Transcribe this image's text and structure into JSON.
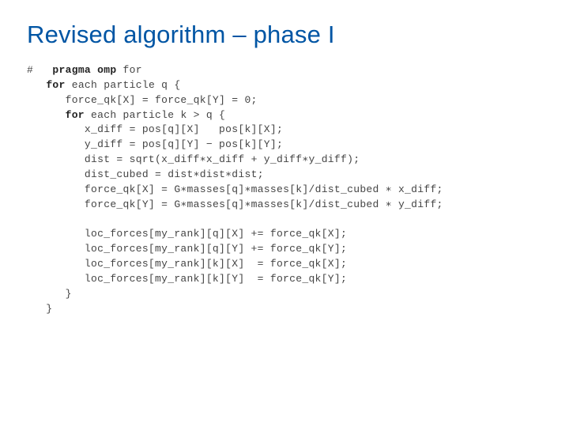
{
  "title": "Revised algorithm – phase I",
  "code": {
    "hash": "#",
    "kw_pragma": "pragma omp",
    "kw_for": "for",
    "pragma_rest": "for",
    "for1_rest": "each particle q {",
    "l1": "      force_qk[X] = force_qk[Y] = 0;",
    "for2_rest": "each particle k > q {",
    "l2": "         x_diff = pos[q][X]   pos[k][X];",
    "l3": "         y_diff = pos[q][Y] − pos[k][Y];",
    "l4": "         dist = sqrt(x_diff∗x_diff + y_diff∗y_diff);",
    "l5": "         dist_cubed = dist∗dist∗dist;",
    "l6": "         force_qk[X] = G∗masses[q]∗masses[k]/dist_cubed ∗ x_diff;",
    "l7": "         force_qk[Y] = G∗masses[q]∗masses[k]/dist_cubed ∗ y_diff;",
    "blank": "",
    "l8": "         loc_forces[my_rank][q][X] += force_qk[X];",
    "l9": "         loc_forces[my_rank][q][Y] += force_qk[Y];",
    "l10": "         loc_forces[my_rank][k][X]  = force_qk[X];",
    "l11": "         loc_forces[my_rank][k][Y]  = force_qk[Y];",
    "l12": "      }",
    "l13": "   }"
  }
}
